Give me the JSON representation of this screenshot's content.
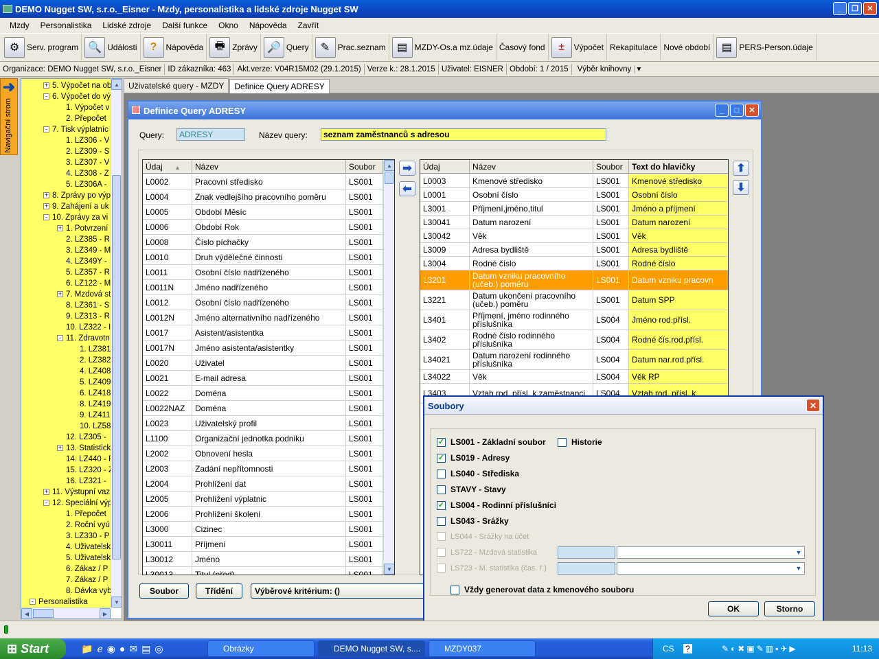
{
  "app": {
    "title": "DEMO Nugget SW, s.r.o._Eisner - Mzdy, personalistika a lidské zdroje Nugget SW"
  },
  "menu": [
    "Mzdy",
    "Personalistika",
    "Lidské zdroje",
    "Další funkce",
    "Okno",
    "Nápověda",
    "Zavřít"
  ],
  "toolbar": [
    {
      "label": "Serv. program",
      "icon": "gear-icon"
    },
    {
      "label": "Události",
      "icon": "magnifier-icon"
    },
    {
      "label": "Nápověda",
      "icon": "question-icon"
    },
    {
      "label": "Zprávy",
      "icon": "printer-icon"
    },
    {
      "label": "Query",
      "icon": "query-icon"
    },
    {
      "label": "Prac.seznam",
      "icon": "pen-icon"
    },
    {
      "label": "MZDY-Os.a mz.údaje",
      "icon": "clipboard-icon"
    },
    {
      "label": "Časový fond",
      "icon": ""
    },
    {
      "label": "Výpočet",
      "icon": "calculator-icon"
    },
    {
      "label": "Rekapitulace",
      "icon": ""
    },
    {
      "label": "Nové období",
      "icon": ""
    },
    {
      "label": "PERS-Person.údaje",
      "icon": "clipboard-icon"
    }
  ],
  "status": {
    "org": "Organizace: DEMO Nugget SW, s.r.o._Eisner",
    "id": "ID zákazníka: 463",
    "aktverze": "Akt.verze: V04R15M02 (29.1.2015)",
    "verze": "Verze k.: 28.1.2015",
    "user": "Uživatel: EISNER",
    "period": "Období: 1 / 2015",
    "books": "Výběr knihovny"
  },
  "nav_tab": "Navigační strom",
  "tree": [
    {
      "t": "5. Výpočet na ob",
      "lvl": 1,
      "pm": "+"
    },
    {
      "t": "6. Výpočet do vý",
      "lvl": 1,
      "pm": "-"
    },
    {
      "t": "1. Výpočet v",
      "lvl": 2,
      "pm": ""
    },
    {
      "t": "2. Přepočet",
      "lvl": 2,
      "pm": ""
    },
    {
      "t": "7. Tisk výplatníc",
      "lvl": 1,
      "pm": "-"
    },
    {
      "t": "1. LZ306 - V",
      "lvl": 2,
      "pm": ""
    },
    {
      "t": "2. LZ309 - S",
      "lvl": 2,
      "pm": ""
    },
    {
      "t": "3. LZ307 - V",
      "lvl": 2,
      "pm": ""
    },
    {
      "t": "4. LZ308 - Z",
      "lvl": 2,
      "pm": ""
    },
    {
      "t": "5. LZ306A -",
      "lvl": 2,
      "pm": ""
    },
    {
      "t": "8. Zprávy po výp",
      "lvl": 1,
      "pm": "+"
    },
    {
      "t": "9. Zahájení a uk",
      "lvl": 1,
      "pm": "+"
    },
    {
      "t": "10. Zprávy za vi",
      "lvl": 1,
      "pm": "-"
    },
    {
      "t": "1. Potvrzení",
      "lvl": 2,
      "pm": "+"
    },
    {
      "t": "2. LZ385 - R",
      "lvl": 2,
      "pm": ""
    },
    {
      "t": "3. LZ349 - M",
      "lvl": 2,
      "pm": ""
    },
    {
      "t": "4. LZ349Y -",
      "lvl": 2,
      "pm": ""
    },
    {
      "t": "5. LZ357 - R",
      "lvl": 2,
      "pm": ""
    },
    {
      "t": "6. LZ122 - M",
      "lvl": 2,
      "pm": ""
    },
    {
      "t": "7. Mzdová st",
      "lvl": 2,
      "pm": "+"
    },
    {
      "t": "8. LZ361 - S",
      "lvl": 2,
      "pm": ""
    },
    {
      "t": "9. LZ313 - R",
      "lvl": 2,
      "pm": ""
    },
    {
      "t": "10. LZ322 - I",
      "lvl": 2,
      "pm": ""
    },
    {
      "t": "11. Zdravotn",
      "lvl": 2,
      "pm": "-"
    },
    {
      "t": "1. LZ381",
      "lvl": 3,
      "pm": ""
    },
    {
      "t": "2. LZ382",
      "lvl": 3,
      "pm": ""
    },
    {
      "t": "4. LZ408",
      "lvl": 3,
      "pm": ""
    },
    {
      "t": "5. LZ409",
      "lvl": 3,
      "pm": ""
    },
    {
      "t": "6. LZ418",
      "lvl": 3,
      "pm": ""
    },
    {
      "t": "8. LZ419",
      "lvl": 3,
      "pm": ""
    },
    {
      "t": "9. LZ411",
      "lvl": 3,
      "pm": ""
    },
    {
      "t": "10. LZ58",
      "lvl": 3,
      "pm": ""
    },
    {
      "t": "12. LZ305 -",
      "lvl": 2,
      "pm": ""
    },
    {
      "t": "13. Statistick",
      "lvl": 2,
      "pm": "+"
    },
    {
      "t": "14. LZ440 - F",
      "lvl": 2,
      "pm": ""
    },
    {
      "t": "15. LZ320 - Z",
      "lvl": 2,
      "pm": ""
    },
    {
      "t": "16. LZ321 -",
      "lvl": 2,
      "pm": ""
    },
    {
      "t": "11. Výstupní vaz",
      "lvl": 1,
      "pm": "+"
    },
    {
      "t": "12. Speciální výp",
      "lvl": 1,
      "pm": "-"
    },
    {
      "t": "1. Přepočet",
      "lvl": 2,
      "pm": ""
    },
    {
      "t": "2. Roční vyú",
      "lvl": 2,
      "pm": ""
    },
    {
      "t": "3. LZ330 - P",
      "lvl": 2,
      "pm": ""
    },
    {
      "t": "4. Uživatelsk",
      "lvl": 2,
      "pm": ""
    },
    {
      "t": "5. Uživatelsk",
      "lvl": 2,
      "pm": ""
    },
    {
      "t": "6. Zákaz / P",
      "lvl": 2,
      "pm": ""
    },
    {
      "t": "7. Zákaz / P",
      "lvl": 2,
      "pm": ""
    },
    {
      "t": "8. Dávka vyb",
      "lvl": 2,
      "pm": ""
    },
    {
      "t": "Personalistika",
      "lvl": 0,
      "pm": "-"
    }
  ],
  "doc_tabs": [
    "Uživatelské query - MZDY",
    "Definice Query ADRESY"
  ],
  "window": {
    "title": "Definice Query ADRESY",
    "query_label": "Query:",
    "query_value": "ADRESY",
    "name_label": "Název query:",
    "name_value": "seznam zaměstnanců s adresou"
  },
  "left_grid": {
    "headers": [
      "Údaj",
      "Název",
      "Soubor"
    ],
    "rows": [
      [
        "L0002",
        "Pracovní středisko",
        "LS001"
      ],
      [
        "L0004",
        "Znak vedlejšího pracovního poměru",
        "LS001"
      ],
      [
        "L0005",
        "Období Měsíc",
        "LS001"
      ],
      [
        "L0006",
        "Období Rok",
        "LS001"
      ],
      [
        "L0008",
        "Číslo píchačky",
        "LS001"
      ],
      [
        "L0010",
        "Druh výdělečné činnosti",
        "LS001"
      ],
      [
        "L0011",
        "Osobní číslo nadřízeného",
        "LS001"
      ],
      [
        "L0011N",
        "Jméno nadřízeného",
        "LS001"
      ],
      [
        "L0012",
        "Osobní číslo nadřízeného",
        "LS001"
      ],
      [
        "L0012N",
        "Jméno alternativního nadřízeného",
        "LS001"
      ],
      [
        "L0017",
        "Asistent/asistentka",
        "LS001"
      ],
      [
        "L0017N",
        "Jméno asistenta/asistentky",
        "LS001"
      ],
      [
        "L0020",
        "Uživatel",
        "LS001"
      ],
      [
        "L0021",
        "E-mail adresa",
        "LS001"
      ],
      [
        "L0022",
        "Doména",
        "LS001"
      ],
      [
        "L0022NAZ",
        "Doména",
        "LS001"
      ],
      [
        "L0023",
        "Uživatelský profil",
        "LS001"
      ],
      [
        "L1100",
        "Organizační jednotka podniku",
        "LS001"
      ],
      [
        "L2002",
        "Obnovení hesla",
        "LS001"
      ],
      [
        "L2003",
        "Zadání nepřítomnosti",
        "LS001"
      ],
      [
        "L2004",
        "Prohlížení dat",
        "LS001"
      ],
      [
        "L2005",
        "Prohlížení výplatnic",
        "LS001"
      ],
      [
        "L2006",
        "Prohlížení školení",
        "LS001"
      ],
      [
        "L3000",
        "Cizinec",
        "LS001"
      ],
      [
        "L30011",
        "Příjmení",
        "LS001"
      ],
      [
        "L30012",
        "Jméno",
        "LS001"
      ],
      [
        "L30013",
        "Titul (před)",
        "LS001"
      ]
    ]
  },
  "right_grid": {
    "headers": [
      "Údaj",
      "Název",
      "Soubor",
      "Text do hlavičky"
    ],
    "rows": [
      [
        "L0003",
        "Kmenové středisko",
        "LS001",
        "Kmenové středisko"
      ],
      [
        "L0001",
        "Osobní číslo",
        "LS001",
        "Osobní číslo"
      ],
      [
        "L3001",
        "Příjmení,jméno,titul",
        "LS001",
        "Jméno a příjmení"
      ],
      [
        "L30041",
        "Datum narození",
        "LS001",
        "Datum narození"
      ],
      [
        "L30042",
        "Věk",
        "LS001",
        "Věk"
      ],
      [
        "L3009",
        "Adresa bydliště",
        "LS001",
        "Adresa bydliště"
      ],
      [
        "L3004",
        "Rodné číslo",
        "LS001",
        "Rodné číslo"
      ],
      [
        "L3201",
        "Datum vzniku pracovního (učeb.) poměru",
        "LS001",
        "Datum vzniku pracovn"
      ],
      [
        "L3221",
        "Datum ukončení pracovního (učeb.) poměru",
        "LS001",
        "Datum SPP"
      ],
      [
        "L3401",
        "Příjmení, jméno rodinného příslušníka",
        "LS004",
        "Jméno rod.přísl."
      ],
      [
        "L3402",
        "Rodné číslo rodinného příslušníka",
        "LS004",
        "Rodné čís.rod.přísl."
      ],
      [
        "L34021",
        "Datum narození rodinného příslušníka",
        "LS004",
        "Datum nar.rod.přísl."
      ],
      [
        "L34022",
        "Věk",
        "LS004",
        "Věk RP"
      ],
      [
        "L3403",
        "Vztah rod. přísl. k zaměstnanci",
        "LS004",
        "Vztah rod. přísl. k"
      ]
    ],
    "selected_index": 7
  },
  "bottom_buttons": {
    "soubor": "Soubor",
    "trideni": "Třídění",
    "kriterium": "Výběrové kritérium:  ()"
  },
  "dialog": {
    "title": "Soubory",
    "items": [
      {
        "label": "LS001 - Základní soubor",
        "checked": true,
        "enabled": true
      },
      {
        "label": "LS019 - Adresy",
        "checked": true,
        "enabled": true
      },
      {
        "label": "LS040 - Střediska",
        "checked": false,
        "enabled": true
      },
      {
        "label": "STAVY - Stavy",
        "checked": false,
        "enabled": true
      },
      {
        "label": "LS004 - Rodinní příslušníci",
        "checked": true,
        "enabled": true
      },
      {
        "label": "LS043 - Srážky",
        "checked": false,
        "enabled": true
      },
      {
        "label": "LS044 - Srážky na účet",
        "checked": false,
        "enabled": false
      },
      {
        "label": "LS722 - Mzdová statistika",
        "checked": false,
        "enabled": false
      },
      {
        "label": "LS723 - M. statistika (čas. ř.)",
        "checked": false,
        "enabled": false
      }
    ],
    "historie": "Historie",
    "always": "Vždy generovat data z kmenového souboru",
    "ok": "OK",
    "cancel": "Storno"
  },
  "taskbar": {
    "start": "Start",
    "tasks": [
      "Obrázky",
      "DEMO Nugget SW, s....",
      "MZDY037"
    ],
    "lang": "CS",
    "clock": "11:13"
  },
  "colors": {
    "highlight_yellow": "#ffff66",
    "selected_orange": "#ff9c00",
    "xp_blue": "#245edb"
  }
}
